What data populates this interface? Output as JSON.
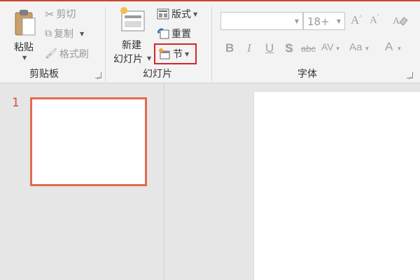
{
  "ribbon": {
    "clipboard": {
      "paste_label": "粘贴",
      "cut_label": "剪切",
      "copy_label": "复制",
      "format_painter_label": "格式刷",
      "group_label": "剪贴板"
    },
    "slides": {
      "new_slide_line1": "新建",
      "new_slide_line2": "幻灯片",
      "layout_label": "版式",
      "reset_label": "重置",
      "section_label": "节",
      "group_label": "幻灯片"
    },
    "font": {
      "font_name_value": "",
      "font_size_value": "18+",
      "grow_label": "A",
      "shrink_label": "A",
      "bold_label": "B",
      "italic_label": "I",
      "underline_label": "U",
      "shadow_label": "S",
      "strikethrough_label": "abc",
      "spacing_label": "AV",
      "case_label": "Aa",
      "color_label": "A",
      "group_label": "字体"
    }
  },
  "thumbnails": {
    "slide_number": "1"
  },
  "colors": {
    "accent": "#c9462c",
    "thumbnail_border": "#e06a50",
    "highlight_box": "#d3262d"
  }
}
